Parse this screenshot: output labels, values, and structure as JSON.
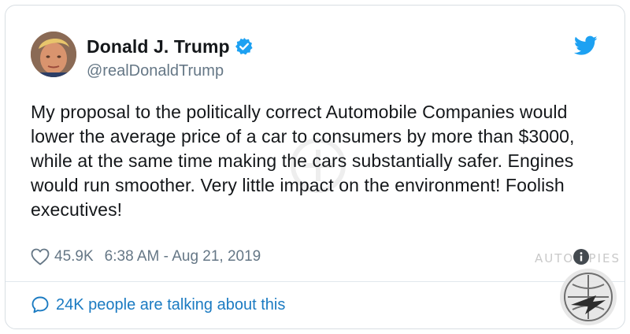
{
  "tweet": {
    "author": {
      "display_name": "Donald J. Trump",
      "handle": "@realDonaldTrump",
      "verified": true,
      "avatar_icon": "profile-photo"
    },
    "text": "My proposal to the politically correct Automobile Companies would lower the average price of a car to consumers by more than $3000, while at the same time making the cars substantially safer. Engines would run smoother. Very little impact on the environment! Foolish executives!",
    "likes": "45.9K",
    "timestamp": "6:38 AM - Aug 21, 2019",
    "talking": "24K people are talking about this"
  },
  "icons": {
    "twitter_logo": "twitter-bird-icon",
    "verified_badge": "verified-badge-icon",
    "like": "heart-icon",
    "info": "info-icon",
    "reply": "speech-bubble-icon"
  },
  "watermark": {
    "text": "AUTO SPIES"
  },
  "colors": {
    "text": "#14171a",
    "secondary": "#657786",
    "brand_blue": "#1da1f2",
    "link_blue": "#1b7bc2",
    "border": "#d8dee3"
  }
}
